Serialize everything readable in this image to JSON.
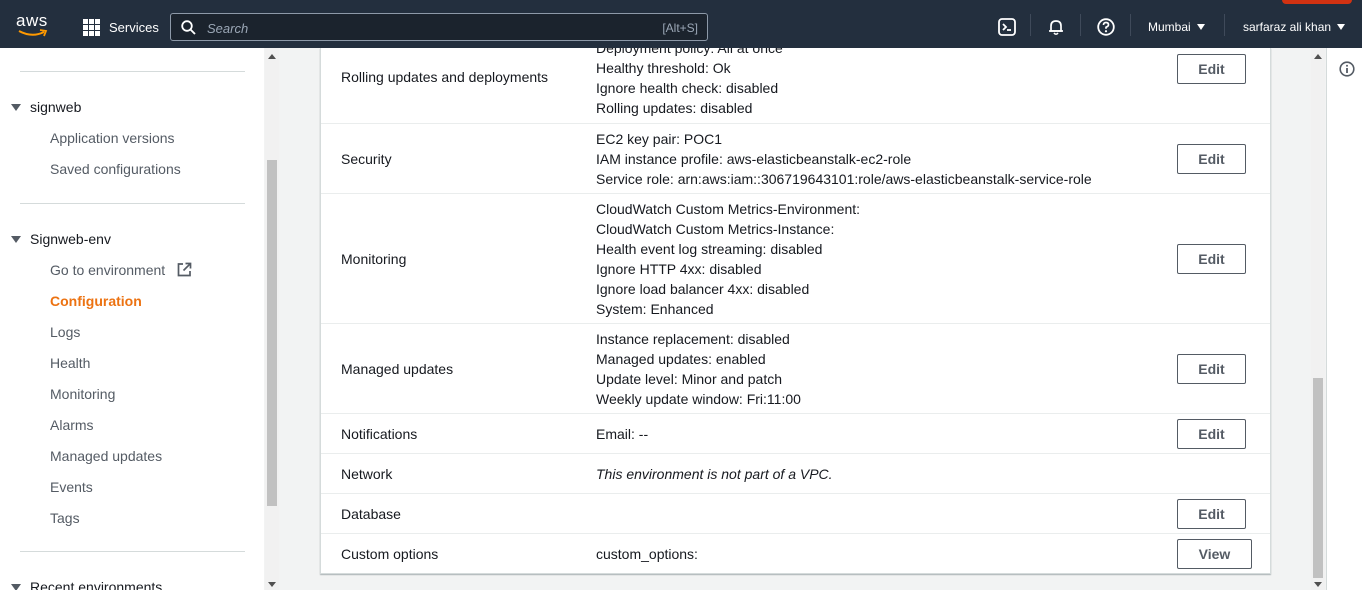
{
  "topnav": {
    "logo_text": "aws",
    "services_label": "Services",
    "search_placeholder": "Search",
    "search_shortcut": "[Alt+S]",
    "region": "Mumbai",
    "user": "sarfaraz ali khan"
  },
  "sidebar": {
    "groups": [
      {
        "label": "signweb",
        "items": [
          "Application versions",
          "Saved configurations"
        ]
      },
      {
        "label": "Signweb-env",
        "items": [
          "Go to environment",
          "Configuration",
          "Logs",
          "Health",
          "Monitoring",
          "Alarms",
          "Managed updates",
          "Events",
          "Tags"
        ]
      },
      {
        "label": "Recent environments"
      }
    ],
    "active_item": "Configuration"
  },
  "config_rows": [
    {
      "category": "Rolling updates and deployments",
      "values": [
        "Deployment policy: All at once",
        "Healthy threshold: Ok",
        "Ignore health check: disabled",
        "Rolling updates: disabled"
      ],
      "button": "Edit"
    },
    {
      "category": "Security",
      "values": [
        "EC2 key pair: POC1",
        "IAM instance profile: aws-elasticbeanstalk-ec2-role",
        "Service role: arn:aws:iam::306719643101:role/aws-elasticbeanstalk-service-role"
      ],
      "button": "Edit"
    },
    {
      "category": "Monitoring",
      "values": [
        "CloudWatch Custom Metrics-Environment:",
        "CloudWatch Custom Metrics-Instance:",
        "Health event log streaming: disabled",
        "Ignore HTTP 4xx: disabled",
        "Ignore load balancer 4xx: disabled",
        "System: Enhanced"
      ],
      "button": "Edit"
    },
    {
      "category": "Managed updates",
      "values": [
        "Instance replacement: disabled",
        "Managed updates: enabled",
        "Update level: Minor and patch",
        "Weekly update window: Fri:11:00"
      ],
      "button": "Edit"
    },
    {
      "category": "Notifications",
      "values": [
        "Email: --"
      ],
      "button": "Edit"
    },
    {
      "category": "Network",
      "values": [
        "This environment is not part of a VPC."
      ],
      "button": ""
    },
    {
      "category": "Database",
      "values": [],
      "button": "Edit"
    },
    {
      "category": "Custom options",
      "values": [
        "custom_options:"
      ],
      "button": "View"
    }
  ],
  "colors": {
    "nav_bg": "#232f3e",
    "accent_active": "#ec7211",
    "text": "#16191f",
    "secondary_text": "#545b64"
  },
  "icons": [
    "grid-icon",
    "search-icon",
    "cloudshell-icon",
    "bell-icon",
    "help-icon",
    "external-link-icon",
    "info-icon"
  ]
}
